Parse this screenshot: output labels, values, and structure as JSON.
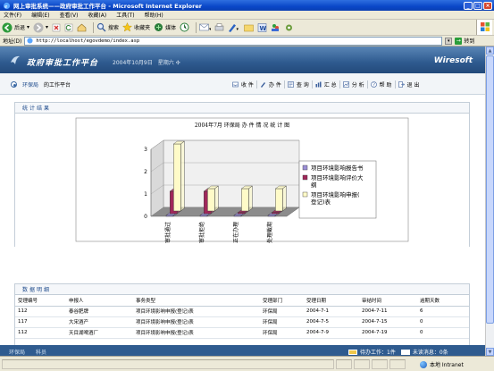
{
  "window": {
    "title": "网上审批系统——政府审批工作平台 - Microsoft Internet Explorer",
    "controls": {
      "minimize": "_",
      "maximize": "□",
      "close": "×"
    }
  },
  "menu": {
    "items": [
      "文件(F)",
      "编辑(E)",
      "查看(V)",
      "收藏(A)",
      "工具(T)",
      "帮助(H)"
    ]
  },
  "toolbar": {
    "back": "后退",
    "search": "搜索",
    "favorites": "收藏夹",
    "media": "媒体"
  },
  "address": {
    "label": "地址(D)",
    "url": "http://localhost/egovdemo/index.asp",
    "go": "转到"
  },
  "app": {
    "system_name": "政府审批工作平台",
    "date": "2004年10月9日　星期六 ✣",
    "brand": "Wiresoft",
    "location_unit": "环保局",
    "location_page": "的工作平台",
    "nav_buttons": [
      "收 件",
      "办 件",
      "查 询",
      "汇 总",
      "分 析",
      "帮 助",
      "退 出"
    ]
  },
  "stats_panel": {
    "title": "统计结果"
  },
  "chart_data": {
    "type": "bar",
    "title": "2004年7月 环保局 办 件 情 况 统 计 图",
    "categories": [
      "审批通过",
      "审批拒绝",
      "正在办理",
      "处理截期"
    ],
    "series": [
      {
        "name": "项目环境影响报告书",
        "color": "#9b8fd6",
        "values": [
          0,
          0,
          0,
          0
        ]
      },
      {
        "name": "项目环境影响评价大纲",
        "color": "#a0285a",
        "values": [
          1,
          1,
          0,
          0
        ]
      },
      {
        "name": "项目环境影响申报(登记)表",
        "color": "#fffbc8",
        "values": [
          3,
          1,
          1,
          1
        ]
      }
    ],
    "ylim": [
      0,
      3
    ],
    "yticks": [
      0,
      1,
      2,
      3
    ],
    "legend_position": "right",
    "grid": true,
    "three_d": true
  },
  "detail_panel": {
    "title": "数据明细",
    "columns": [
      "受理编号",
      "申报人",
      "事务类型",
      "受理部门",
      "受理日期",
      "审结时间",
      "逾期天数"
    ],
    "rows": [
      [
        "112",
        "泰谷肥牌",
        "项目环境影响申报(登记)表",
        "环保局",
        "2004-7-1",
        "2004-7-11",
        "6"
      ],
      [
        "117",
        "大宋酒产",
        "项目环境影响申报(登记)表",
        "环保局",
        "2004-7-5",
        "2004-7-15",
        "0"
      ],
      [
        "112",
        "天目湖啤酒厂",
        "项目环境影响申报(登记)表",
        "环保局",
        "2004-7-9",
        "2004-7-19",
        "0"
      ]
    ]
  },
  "app_footer": {
    "user": [
      "环保局",
      "科员"
    ],
    "pending_label": "待办工作：1件",
    "mail_label": "未读消息：0条"
  },
  "status": {
    "zone": "本地 Intranet"
  }
}
